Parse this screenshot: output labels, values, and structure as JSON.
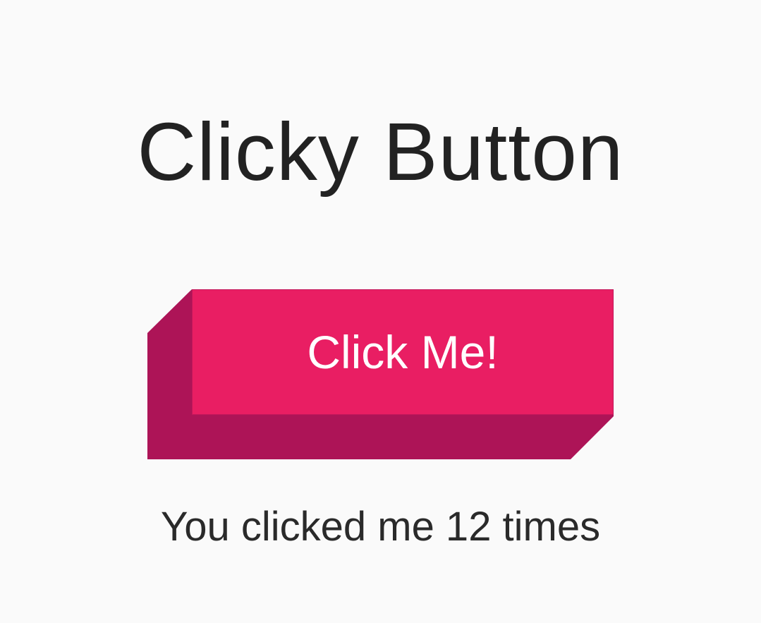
{
  "page": {
    "title": "Clicky Button"
  },
  "button": {
    "label": "Click Me!",
    "face_color": "#e91e63",
    "side_color": "#ad1457"
  },
  "status": {
    "click_text": "You clicked me 12 times"
  },
  "colors": {
    "background": "#fafafa",
    "text": "#222222"
  }
}
